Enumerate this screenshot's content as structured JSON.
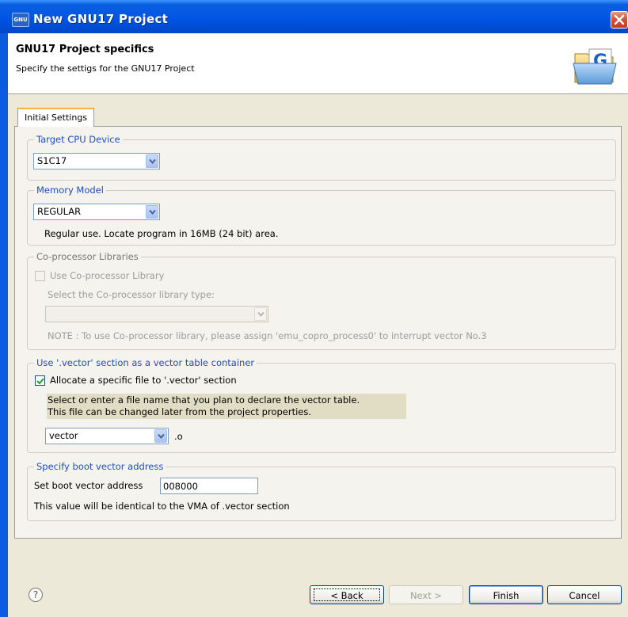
{
  "window": {
    "title": "New GNU17 Project",
    "icon_label": "GNU"
  },
  "header": {
    "title": "GNU17 Project specifics",
    "description": "Specify the settigs for the GNU17 Project",
    "icon": "folder-g-icon"
  },
  "tabs": [
    {
      "label": "Initial Settings",
      "selected": true
    }
  ],
  "target_cpu": {
    "legend": "Target CPU Device",
    "selected": "S1C17"
  },
  "memory_model": {
    "legend": "Memory Model",
    "selected": "REGULAR",
    "description": "Regular use. Locate program in 16MB (24 bit) area."
  },
  "coprocessor": {
    "legend": "Co-processor Libraries",
    "checkbox_label": "Use Co-processor Library",
    "checked": false,
    "select_label": "Select the Co-processor library type:",
    "selected": "",
    "note": "NOTE : To use Co-processor library, please assign 'emu_copro_process0' to interrupt vector No.3"
  },
  "vector_section": {
    "legend": "Use '.vector' section as a vector table container",
    "checkbox_label": "Allocate a specific file to '.vector' section",
    "checked": true,
    "info_line1": "Select or enter a file name that you plan to declare the vector table.",
    "info_line2": "This file can be changed later from the project properties.",
    "file_value": "vector",
    "file_ext": ".o"
  },
  "boot_vector": {
    "legend": "Specify boot vector address",
    "label": "Set boot vector address",
    "value": "008000",
    "note": "This value will be identical to the VMA of .vector section"
  },
  "footer": {
    "help": "?",
    "back": "< Back",
    "next": "Next >",
    "finish": "Finish",
    "cancel": "Cancel"
  },
  "colors": {
    "title_bar": "#0055e5",
    "legend_blue": "#1f4cc8",
    "close_red": "#d5533a",
    "tab_accent": "#ffb13a"
  }
}
